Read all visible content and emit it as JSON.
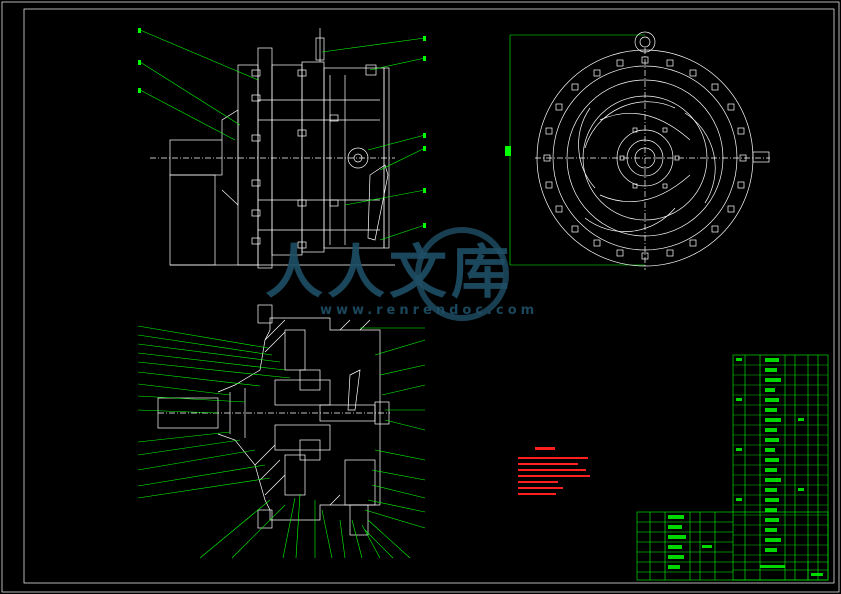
{
  "watermark": {
    "characters": "人人文库",
    "url": "www.renrendoc.com",
    "color": "#1f4f66"
  },
  "colors": {
    "background": "#000000",
    "geometry": "#ffffff",
    "leaders": "#00ff00",
    "notes": "#ff2020"
  }
}
